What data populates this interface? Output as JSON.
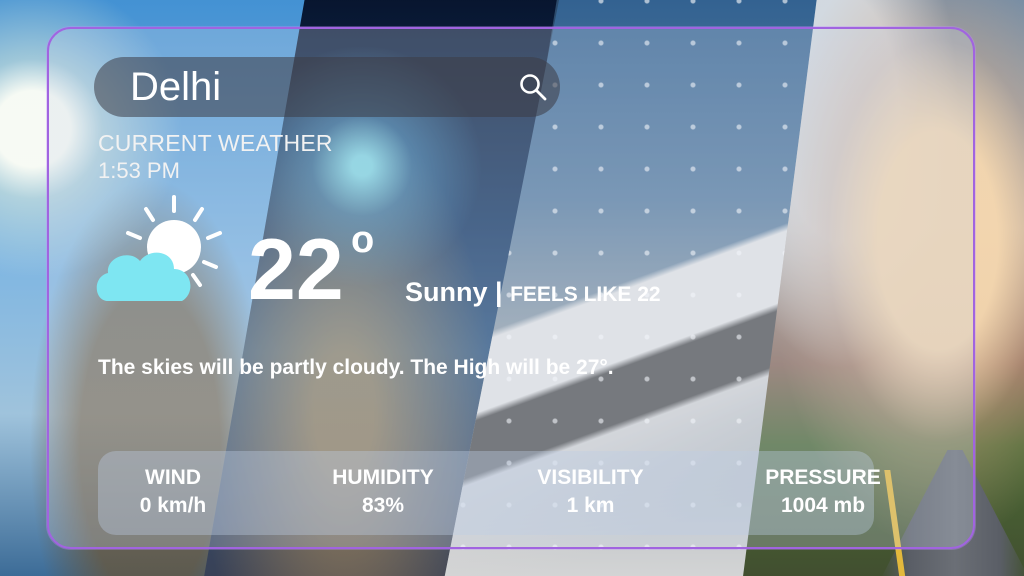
{
  "search": {
    "value": "Delhi"
  },
  "current": {
    "label": "CURRENT WEATHER",
    "time": "1:53 PM",
    "icon": "partly-cloudy-icon",
    "temperature": "22",
    "degree_symbol": "o",
    "condition": "Sunny",
    "separator": " | ",
    "feels_like": "FEELS LIKE 22",
    "summary": "The skies will be partly cloudy. The High will be 27°."
  },
  "stats": [
    {
      "label": "WIND",
      "value": "0 km/h"
    },
    {
      "label": "HUMIDITY",
      "value": "83%"
    },
    {
      "label": "VISIBILITY",
      "value": "1 km"
    },
    {
      "label": "PRESSURE",
      "value": "1004 mb"
    }
  ],
  "colors": {
    "card_border": "#a164e0",
    "cloud": "#7ee6f2",
    "text": "#ffffff"
  }
}
